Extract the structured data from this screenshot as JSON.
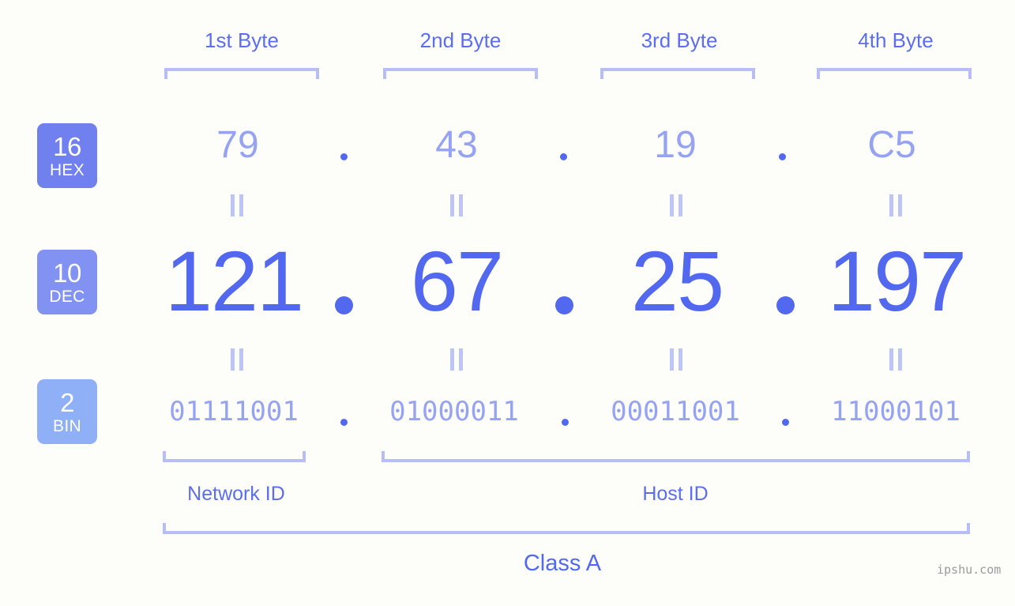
{
  "meta": {
    "background_color": "#fdfdfa",
    "accent_dark": "#5268ef",
    "accent_mid": "#5b6ef0",
    "accent_light": "#96a3f2",
    "bracket_color": "#b6bdf7",
    "watermark": "ipshu.com"
  },
  "byte_headers": [
    {
      "label": "1st Byte"
    },
    {
      "label": "2nd Byte"
    },
    {
      "label": "3rd Byte"
    },
    {
      "label": "4th Byte"
    }
  ],
  "rows": [
    {
      "badge": {
        "number": "16",
        "name": "HEX",
        "color": "#7080ee"
      },
      "values": [
        "79",
        "43",
        "19",
        "C5"
      ],
      "separator": "."
    },
    {
      "badge": {
        "number": "10",
        "name": "DEC",
        "color": "#8292f2"
      },
      "values": [
        "121",
        "67",
        "25",
        "197"
      ],
      "separator": "."
    },
    {
      "badge": {
        "number": "2",
        "name": "BIN",
        "color": "#8fb0f7"
      },
      "values": [
        "01111001",
        "01000011",
        "00011001",
        "11000101"
      ],
      "separator": "."
    }
  ],
  "equals_marks": {
    "symbol": "=",
    "count_per_gap": 4
  },
  "sections": [
    {
      "label": "Network ID"
    },
    {
      "label": "Host ID"
    }
  ],
  "class": {
    "label": "Class A"
  }
}
